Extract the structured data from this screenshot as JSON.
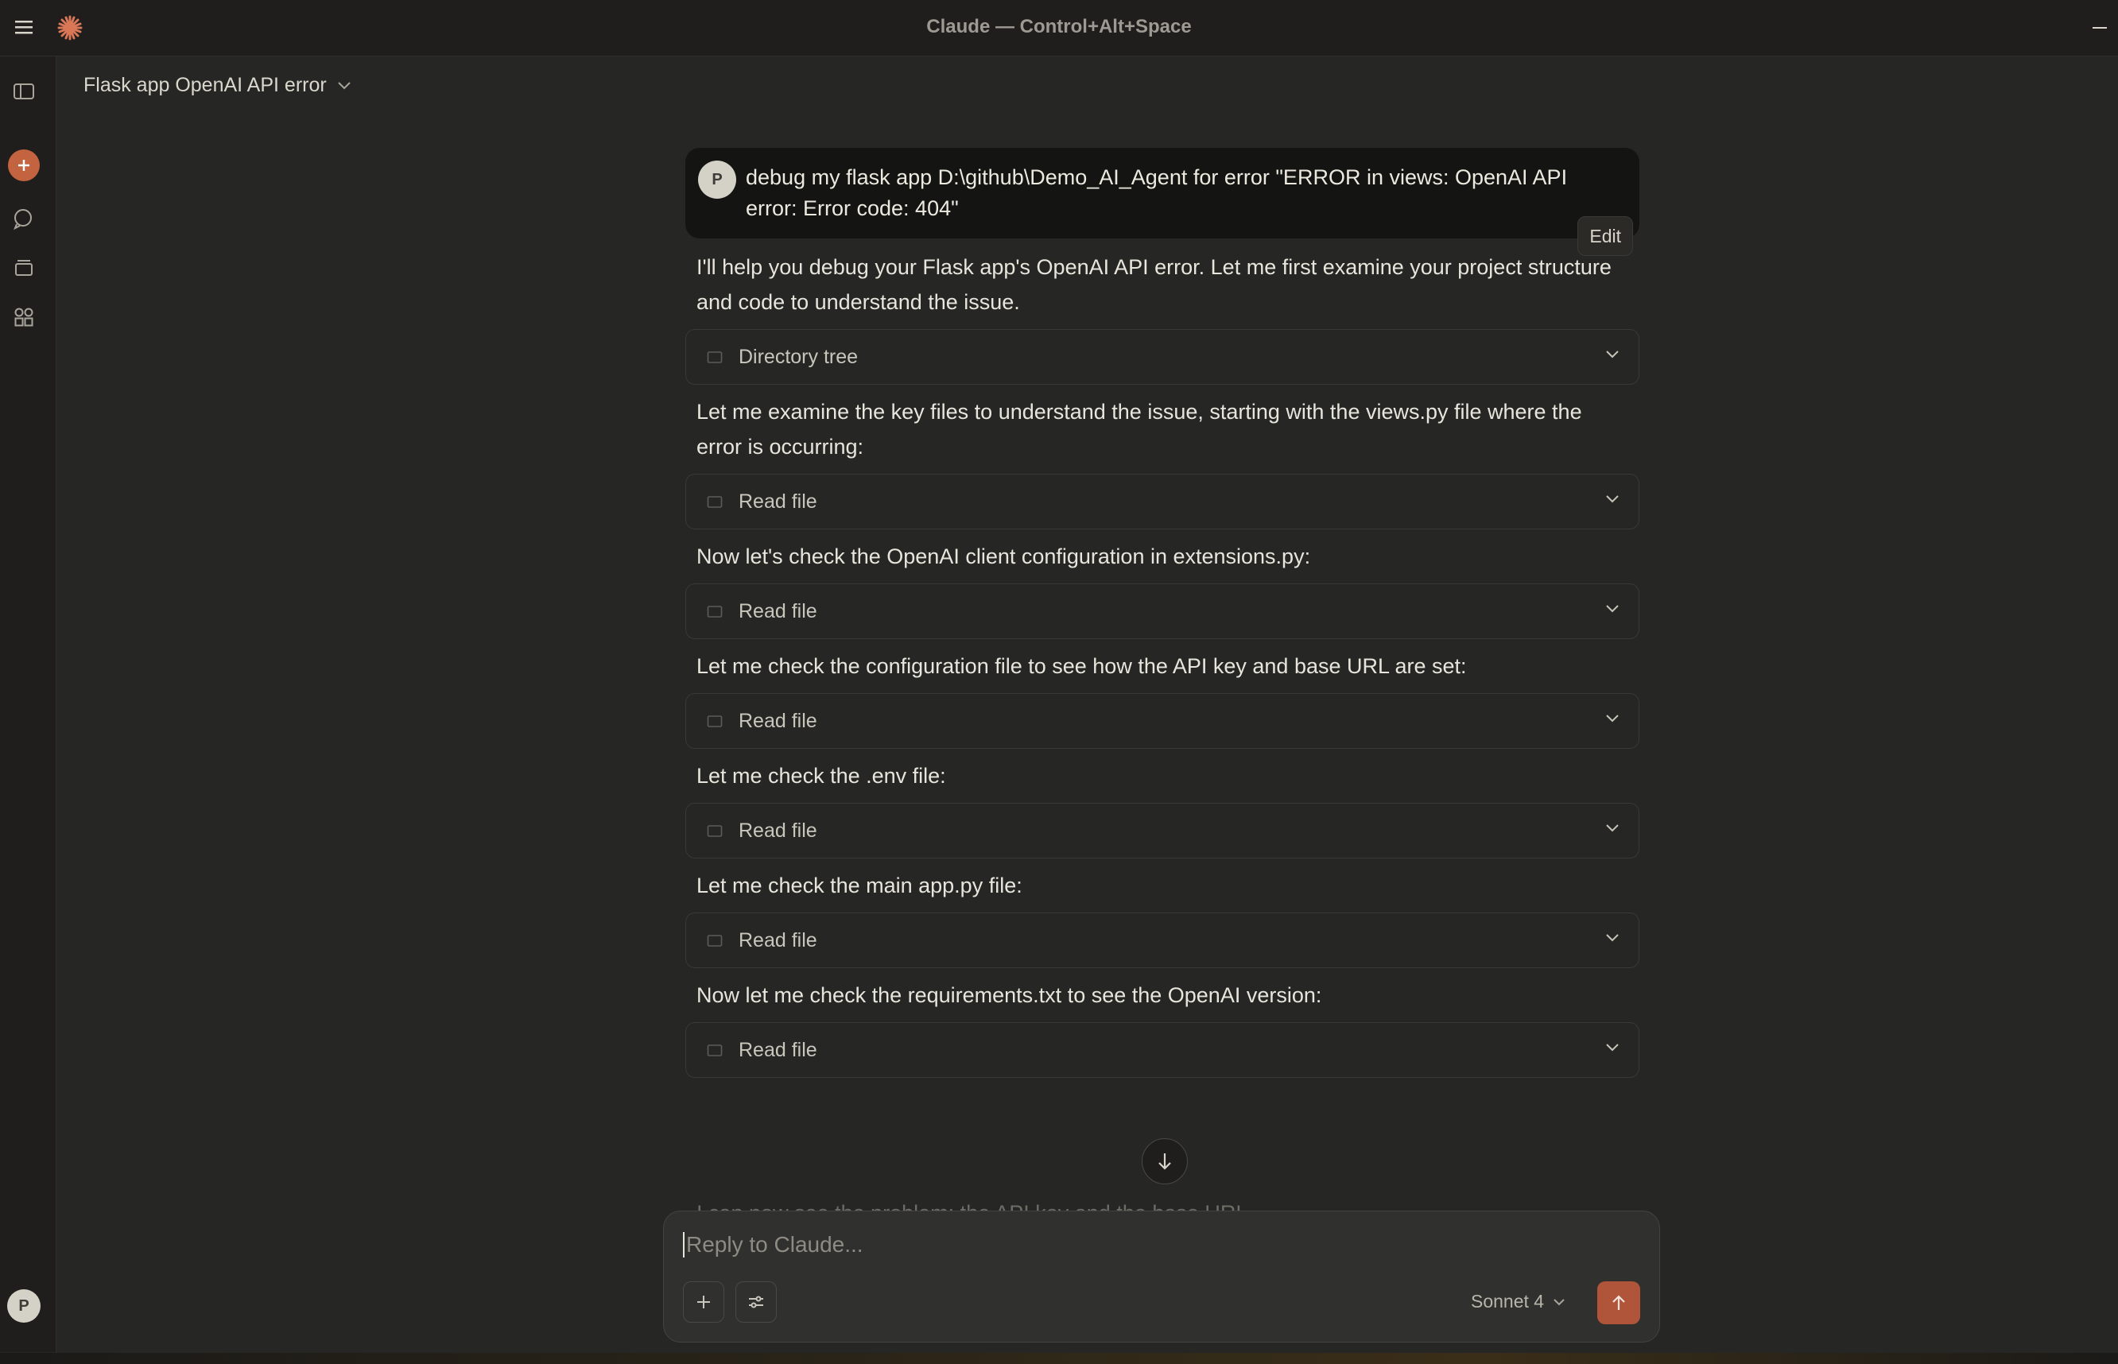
{
  "window": {
    "title": "Claude — Control+Alt+Space"
  },
  "conversation": {
    "title": "Flask app OpenAI API error"
  },
  "sidebar": {
    "user_initial": "P"
  },
  "messages": {
    "user": {
      "initial": "P",
      "text": "debug my flask app D:\\github\\Demo_AI_Agent for error \"ERROR in views: OpenAI API error: Error code: 404\"",
      "edit_label": "Edit"
    },
    "assistant": [
      {
        "text": "I'll help you debug your Flask app's OpenAI API error. Let me first examine your project structure and code to understand the issue.",
        "tool": "Directory tree"
      },
      {
        "text": "Let me examine the key files to understand the issue, starting with the views.py file where the error is occurring:",
        "tool": "Read file"
      },
      {
        "text": "Now let's check the OpenAI client configuration in extensions.py:",
        "tool": "Read file"
      },
      {
        "text": "Let me check the configuration file to see how the API key and base URL are set:",
        "tool": "Read file"
      },
      {
        "text": "Let me check the .env file:",
        "tool": "Read file"
      },
      {
        "text": "Let me check the main app.py file:",
        "tool": "Read file"
      },
      {
        "text": "Now let me check the requirements.txt to see the OpenAI version:",
        "tool": "Read file"
      }
    ],
    "partial_text": "I can now see the problem: the API key and the base URL..."
  },
  "composer": {
    "placeholder": "Reply to Claude...",
    "model": "Sonnet 4"
  },
  "colors": {
    "accent": "#b0553a",
    "brand": "#d97757",
    "background": "#262624"
  }
}
